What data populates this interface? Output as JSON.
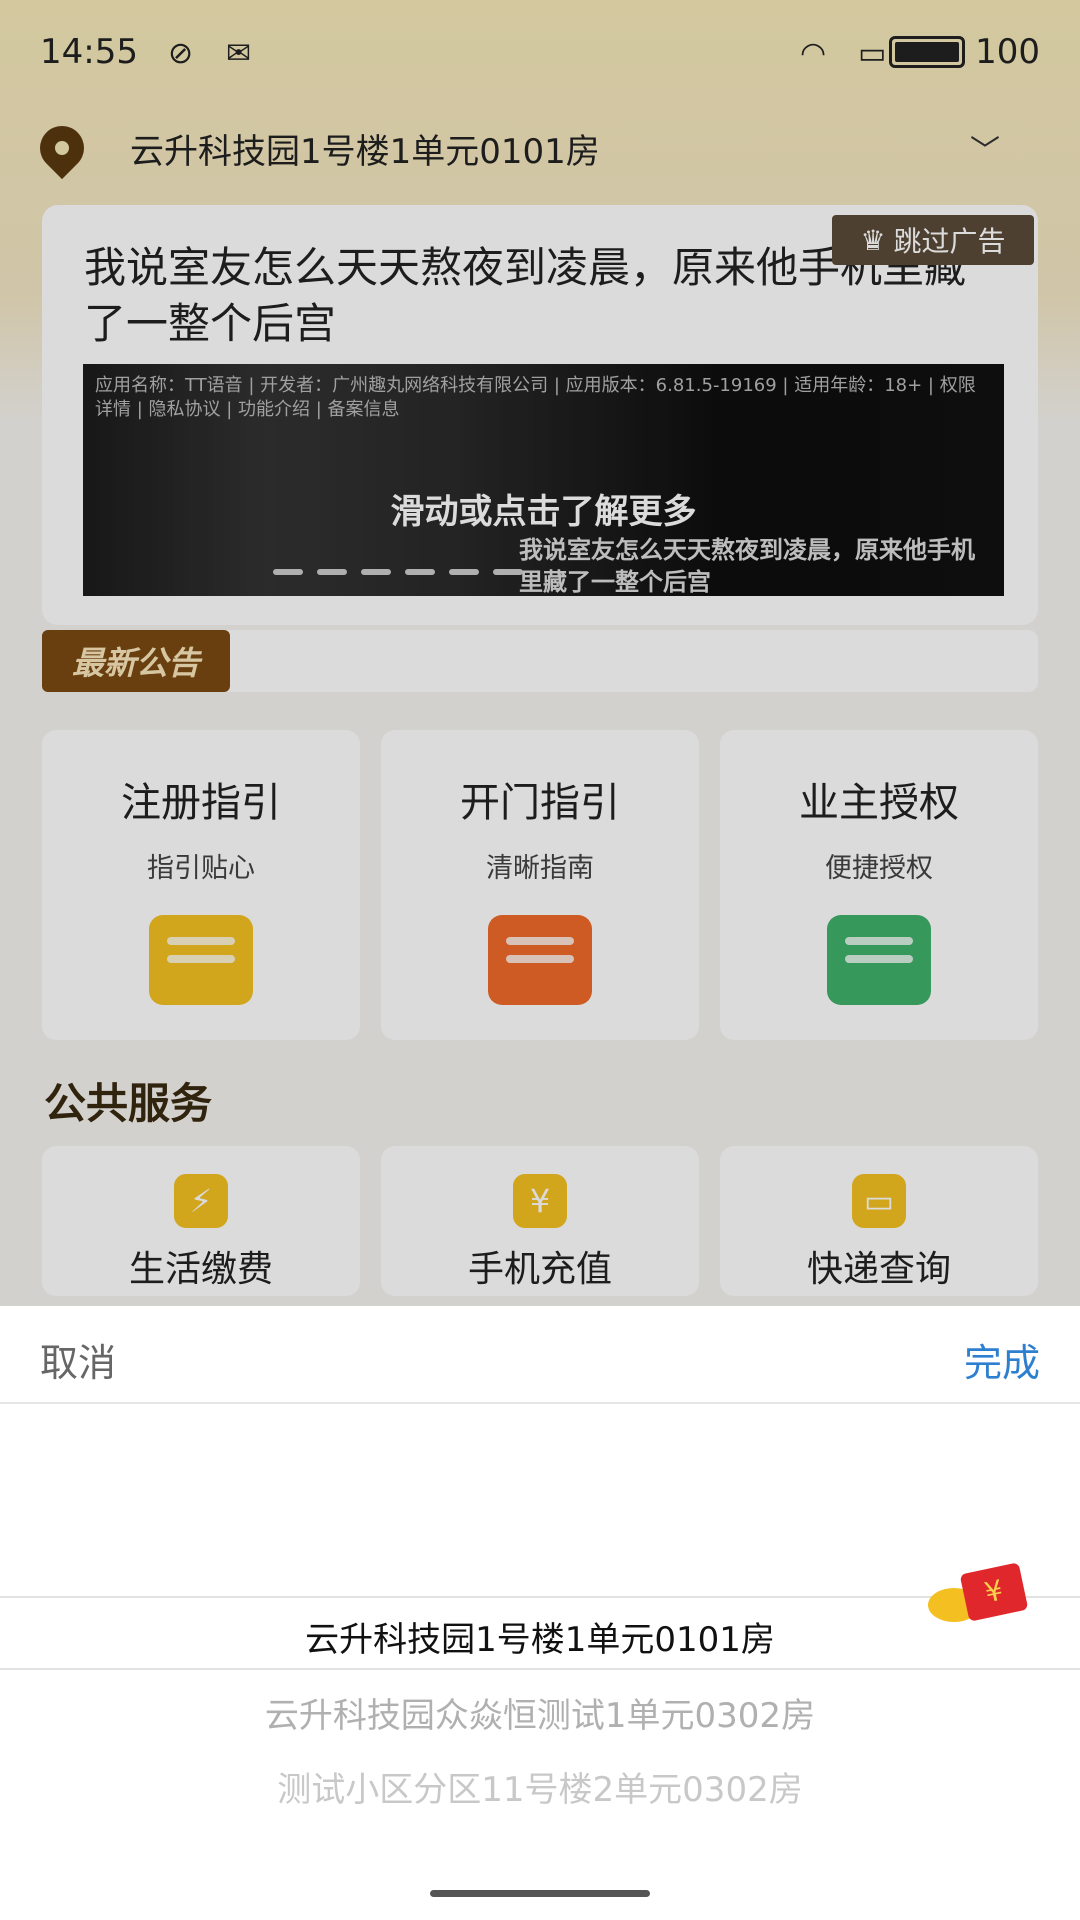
{
  "status_bar": {
    "time": "14:55",
    "battery": "100"
  },
  "header": {
    "address": "云升科技园1号楼1单元0101房"
  },
  "ad": {
    "title": "我说室友怎么天天熬夜到凌晨，原来他手机里藏了一整个后宫",
    "skip_label": "跳过广告",
    "meta": "应用名称：TT语音 | 开发者：广州趣丸网络科技有限公司 | 应用版本：6.81.5-19169 | 适用年龄：18+ | 权限详情 | 隐私协议 | 功能介绍 | 备案信息",
    "cta": "滑动或点击了解更多",
    "subtitle": "我说室友怎么天天熬夜到凌晨，原来他手机里藏了一整个后宫"
  },
  "notice": {
    "tag": "最新公告"
  },
  "guides": [
    {
      "title": "注册指引",
      "sub": "指引贴心",
      "icon": "id-card-icon",
      "color": "#f4c021"
    },
    {
      "title": "开门指引",
      "sub": "清晰指南",
      "icon": "unlock-icon",
      "color": "#f06a2a"
    },
    {
      "title": "业主授权",
      "sub": "便捷授权",
      "icon": "document-stamp-icon",
      "color": "#3fb36a"
    }
  ],
  "public_services": {
    "title": "公共服务",
    "items": [
      {
        "label": "生活缴费",
        "icon": "lightning-icon",
        "glyph": "⚡"
      },
      {
        "label": "手机充值",
        "icon": "phone-yuan-icon",
        "glyph": "¥"
      },
      {
        "label": "快递查询",
        "icon": "package-icon",
        "glyph": "▭"
      }
    ]
  },
  "picker": {
    "cancel": "取消",
    "done": "完成",
    "options": [
      "云升科技园1号楼1单元0101房",
      "云升科技园众焱恒测试1单元0302房",
      "测试小区分区11号楼2单元0302房"
    ],
    "selected_index": 0
  },
  "colors": {
    "accent": "#2f7fd0",
    "brand": "#7b4a12"
  }
}
